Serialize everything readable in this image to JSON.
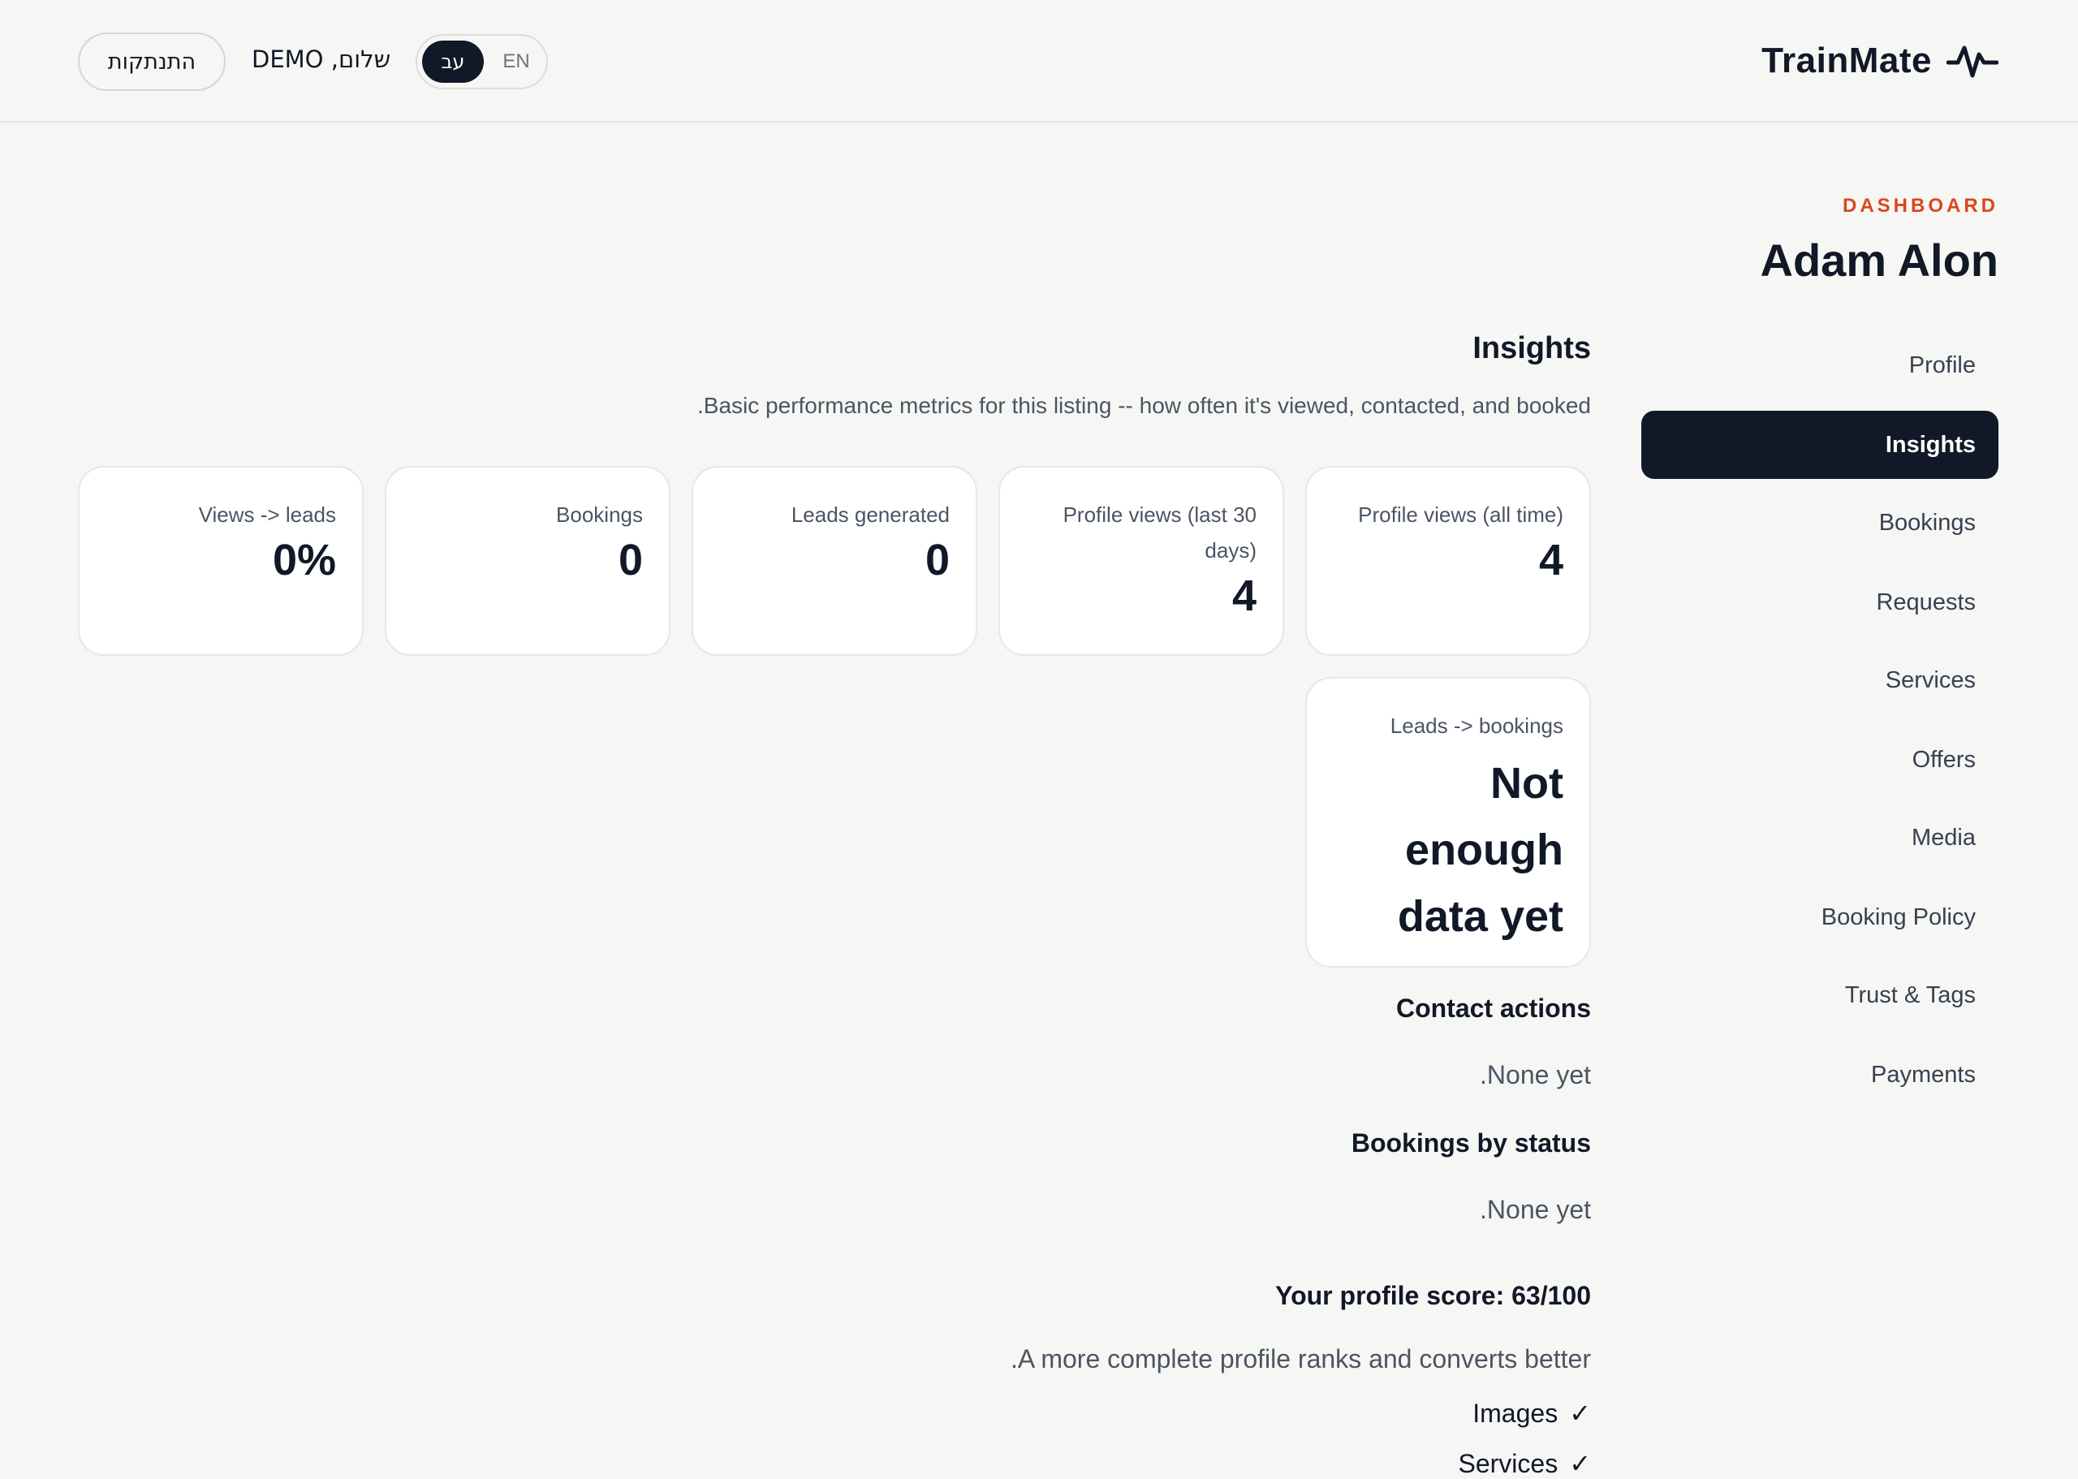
{
  "header": {
    "brand": "TrainMate",
    "logout_label": "התנתקות",
    "greeting": "שלום, DEMO",
    "lang_he": "עב",
    "lang_en": "EN"
  },
  "sidebar": {
    "kicker": "DASHBOARD",
    "name": "Adam Alon",
    "items": [
      {
        "label": "Profile",
        "active": false
      },
      {
        "label": "Insights",
        "active": true
      },
      {
        "label": "Bookings",
        "active": false
      },
      {
        "label": "Requests",
        "active": false
      },
      {
        "label": "Services",
        "active": false
      },
      {
        "label": "Offers",
        "active": false
      },
      {
        "label": "Media",
        "active": false
      },
      {
        "label": "Booking Policy",
        "active": false
      },
      {
        "label": "Trust & Tags",
        "active": false
      },
      {
        "label": "Payments",
        "active": false
      }
    ]
  },
  "insights": {
    "title": "Insights",
    "description": ".Basic performance metrics for this listing -- how often it's viewed, contacted, and booked",
    "cards": [
      {
        "label": "Profile views (all time)",
        "value": "4"
      },
      {
        "label": "Profile views (last 30 days)",
        "value": "4"
      },
      {
        "label": "Leads generated",
        "value": "0"
      },
      {
        "label": "Bookings",
        "value": "0"
      },
      {
        "label": "Views -> leads",
        "value": "0%"
      },
      {
        "label": "Leads -> bookings",
        "value": "Not enough data yet"
      }
    ],
    "contact_actions": {
      "title": "Contact actions",
      "empty": ".None yet"
    },
    "bookings_by_status": {
      "title": "Bookings by status",
      "empty": ".None yet"
    },
    "profile_score": {
      "title": "Your profile score: 63/100",
      "subtitle": ".A more complete profile ranks and converts better",
      "checklist": [
        {
          "label": "Images",
          "done": true
        },
        {
          "label": "Services",
          "done": true
        }
      ]
    }
  }
}
